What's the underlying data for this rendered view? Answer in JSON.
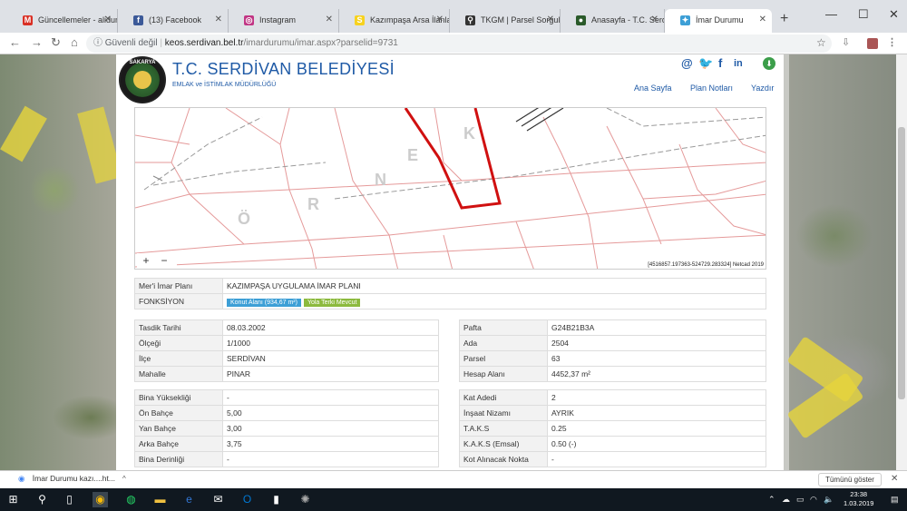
{
  "browser": {
    "tabs": [
      {
        "title": "Güncellemeler - alidun",
        "icon": "gmail-icon",
        "icon_text": "M",
        "color": "#d93025"
      },
      {
        "title": "(13) Facebook",
        "icon": "facebook-icon",
        "icon_text": "f",
        "color": "#3b5998"
      },
      {
        "title": "Instagram",
        "icon": "instagram-icon",
        "icon_text": "◎",
        "color": "#c13584"
      },
      {
        "title": "Kazımpaşa Arsa İlanları",
        "icon": "sahibinden-icon",
        "icon_text": "S",
        "color": "#f7d21e"
      },
      {
        "title": "TKGM | Parsel Sorgula",
        "icon": "map-pin-icon",
        "icon_text": "⚲",
        "color": "#333333"
      },
      {
        "title": "Anasayfa - T.C. Serdiv",
        "icon": "serdivan-icon",
        "icon_text": "●",
        "color": "#2a5a2a"
      },
      {
        "title": "İmar Durumu",
        "icon": "imar-icon",
        "icon_text": "✦",
        "color": "#3d9fd6",
        "active": true
      }
    ],
    "security_label": "Güvenli değil",
    "url_host": "keos.serdivan.bel.tr",
    "url_path": "/imardurumu/imar.aspx?parselid=9731"
  },
  "header": {
    "logo_text": "SAKARYA",
    "title": "T.C. SERDİVAN BELEDİYESİ",
    "subtitle": "EMLAK ve İSTİMLAK MÜDÜRLÜĞÜ",
    "nav": [
      "Ana Sayfa",
      "Plan Notları",
      "Yazdır"
    ]
  },
  "map": {
    "zoom_in": "+",
    "zoom_out": "−",
    "coords": "[4516857.197363-524729.283324] Netcad 2019",
    "letters": [
      "Ö",
      "R",
      "N",
      "E",
      "K"
    ]
  },
  "plan": {
    "plan_label": "Mer'i İmar Planı",
    "plan_value": "KAZIMPAŞA UYGULAMA İMAR PLANI",
    "function_label": "FONKSİYON",
    "badges": [
      "Konut Alanı (934,67 m²)",
      "Yola Terki Mevcut"
    ]
  },
  "left1": [
    {
      "k": "Tasdik Tarihi",
      "v": "08.03.2002"
    },
    {
      "k": "Ölçeği",
      "v": "1/1000"
    },
    {
      "k": "İlçe",
      "v": "SERDİVAN"
    },
    {
      "k": "Mahalle",
      "v": "PINAR"
    }
  ],
  "right1": [
    {
      "k": "Pafta",
      "v": "G24B21B3A"
    },
    {
      "k": "Ada",
      "v": "2504"
    },
    {
      "k": "Parsel",
      "v": "63"
    },
    {
      "k": "Hesap Alanı",
      "v": "4452,37 m²"
    }
  ],
  "left2": [
    {
      "k": "Bina Yüksekliği",
      "v": "-"
    },
    {
      "k": "Ön Bahçe",
      "v": "5,00"
    },
    {
      "k": "Yan Bahçe",
      "v": "3,00"
    },
    {
      "k": "Arka Bahçe",
      "v": "3,75"
    },
    {
      "k": "Bina Derinliği",
      "v": "-"
    }
  ],
  "right2": [
    {
      "k": "Kat Adedi",
      "v": "2"
    },
    {
      "k": "İnşaat Nizamı",
      "v": "AYRIK"
    },
    {
      "k": "T.A.K.S",
      "v": "0.25"
    },
    {
      "k": "K.A.K.S (Emsal)",
      "v": "0.50 (-)"
    },
    {
      "k": "Kot Alınacak Nokta",
      "v": "-"
    }
  ],
  "download": {
    "file": "İmar Durumu kazı....ht...",
    "show_all": "Tümünü göster"
  },
  "taskbar": {
    "time": "23:38",
    "date": "1.03.2019"
  }
}
